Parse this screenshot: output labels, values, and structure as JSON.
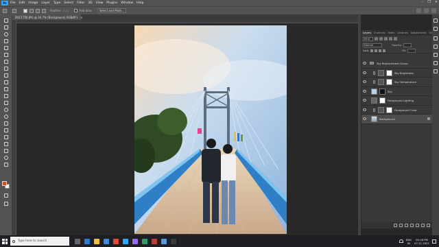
{
  "app": {
    "logo": "Ps"
  },
  "menu": {
    "items": [
      "File",
      "Edit",
      "Image",
      "Layer",
      "Type",
      "Select",
      "Filter",
      "3D",
      "View",
      "Plugins",
      "Window",
      "Help"
    ]
  },
  "window_controls": [
    "–",
    "❐",
    "✕"
  ],
  "options_bar": {
    "feather_label": "Feather:",
    "feather_value": "0 px",
    "anti_alias_label": "Anti-alias",
    "select_mask_label": "Select and Mask..."
  },
  "document": {
    "tab_label": "DSC1756.JPG @ 16.7% (Background, RGB/8*)",
    "close": "×"
  },
  "layers_panel": {
    "tabs": [
      "Layers",
      "Channels",
      "Paths",
      "Libraries",
      "Adjustments",
      "Styles"
    ],
    "filter": {
      "kind_label": "Kind"
    },
    "blend_mode": "Normal",
    "opacity_label": "Opacity:",
    "fill_label": "Fill:",
    "lock_label": "Lock:",
    "layers": [
      {
        "name": "Sky Replacement Group"
      },
      {
        "name": "Sky Brightness"
      },
      {
        "name": "Sky Temperature"
      },
      {
        "name": "Sky"
      },
      {
        "name": "Foreground Lighting"
      },
      {
        "name": "Foreground Color"
      },
      {
        "name": "Background"
      }
    ]
  },
  "taskbar": {
    "search_placeholder": "Type here to search",
    "lang_top": "ENG",
    "lang_bottom": "IN",
    "time": "05:18 PM",
    "date": "07-11-2021"
  },
  "colors": {
    "accent": "#31a8ff",
    "foreground_swatch": "#d24a2c",
    "background_swatch": "#f2f2f2"
  }
}
